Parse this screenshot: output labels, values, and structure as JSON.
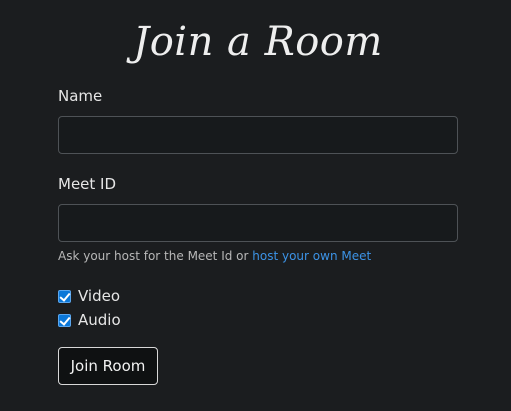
{
  "title": "Join a Room",
  "form": {
    "name_label": "Name",
    "name_value": "",
    "meet_id_label": "Meet ID",
    "meet_id_value": "",
    "help_text": "Ask your host for the Meet Id or ",
    "help_link": "host your own Meet",
    "options": [
      {
        "label": "Video",
        "checked": true
      },
      {
        "label": "Audio",
        "checked": true
      }
    ],
    "submit_label": "Join Room"
  },
  "colors": {
    "background": "#1b1d1f",
    "input_border": "#4e5256",
    "link": "#3c93e6",
    "checkbox": "#0b77d8"
  }
}
